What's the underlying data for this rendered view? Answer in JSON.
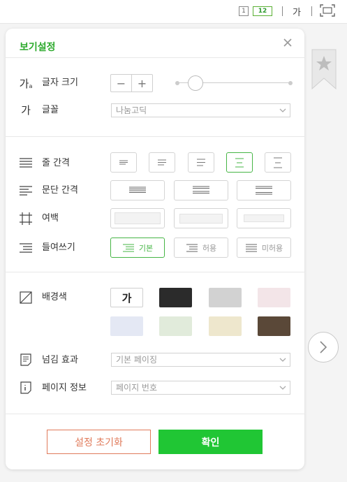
{
  "toolbar": {
    "page_single": "1",
    "page_double": "12",
    "font_icon_glyph": "가",
    "icons": [
      "single-page-icon",
      "double-page-icon",
      "font-settings-icon",
      "fullscreen-icon"
    ]
  },
  "panel": {
    "title": "보기설정",
    "close_icon": "close-icon",
    "font_size": {
      "icon_glyph": "가",
      "label": "글자 크기",
      "minus": "−",
      "plus": "+",
      "level": 0.12
    },
    "font_family": {
      "icon_glyph": "가",
      "label": "글꼴",
      "value": "나눔고딕"
    },
    "line_spacing": {
      "label": "줄 간격",
      "options": 5,
      "selected_index": 3
    },
    "paragraph_spacing": {
      "label": "문단 간격",
      "options": 3
    },
    "margin": {
      "label": "여백",
      "options": 3
    },
    "indent": {
      "label": "들여쓰기",
      "options": [
        "기본",
        "허용",
        "미허용"
      ],
      "selected_index": 0
    },
    "background": {
      "label": "배경색",
      "default_swatch_text": "가",
      "colors": [
        "#ffffff",
        "#2b2b2b",
        "#d2d2d2",
        "#f3e5e8",
        "#e4e8f4",
        "#e1ebdb",
        "#eee7cd",
        "#5a4838"
      ]
    },
    "page_turn": {
      "label": "넘김 효과",
      "value": "기본 페이징"
    },
    "page_info": {
      "label": "페이지 정보",
      "value": "페이지 번호"
    },
    "reset_label": "설정 초기화",
    "confirm_label": "확인"
  },
  "side": {
    "bookmark_icon": "bookmark-star-icon",
    "next_icon": "chevron-right-icon"
  }
}
